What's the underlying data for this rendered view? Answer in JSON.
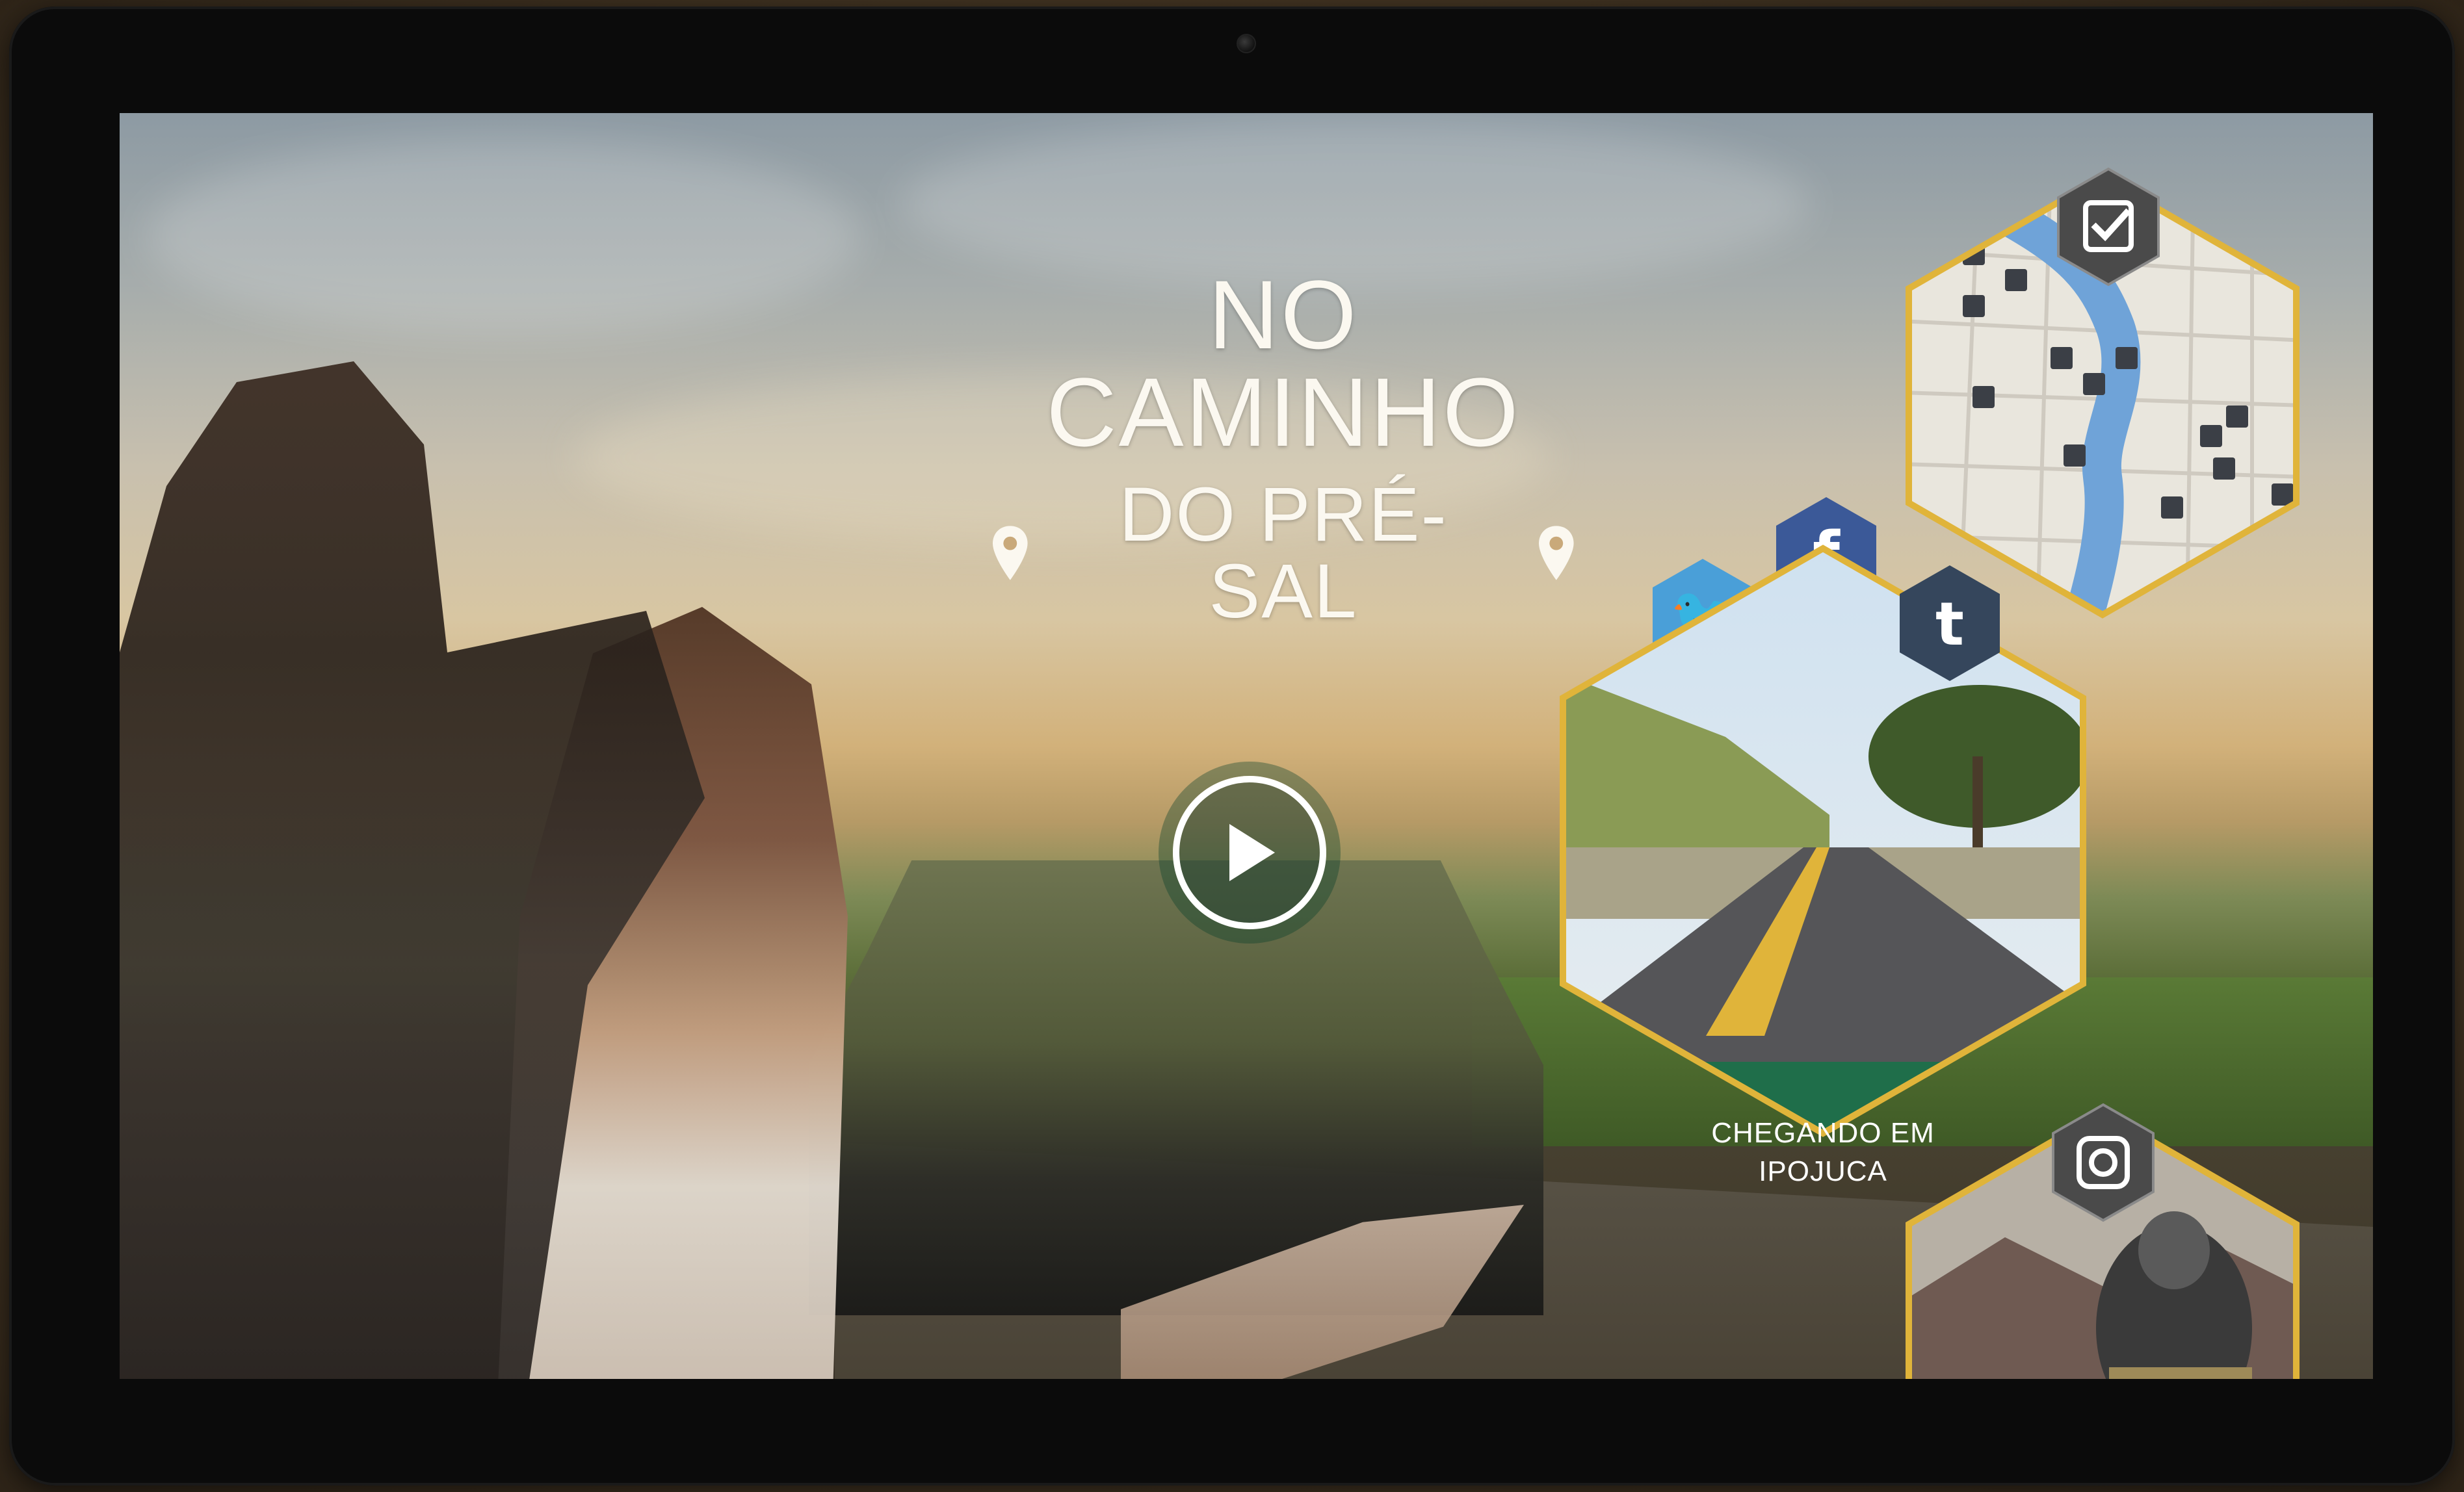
{
  "device": {
    "camera_icon": "camera-dot"
  },
  "hero": {
    "title_line1": "NO CAMINHO",
    "title_line2": "DO PRÉ-SAL",
    "pin_icon": "map-pin-icon"
  },
  "video": {
    "play_icon": "play-icon"
  },
  "map_tile": {
    "badge_icon": "checkin-icon"
  },
  "social": [
    {
      "name": "twitter",
      "glyph": "🐦",
      "color": "#4a9fd8"
    },
    {
      "name": "facebook",
      "glyph": "f",
      "color": "#3b5998"
    },
    {
      "name": "tumblr",
      "glyph": "t",
      "color": "#35465c"
    }
  ],
  "location_card": {
    "caption_line1": "CHEGANDO EM",
    "caption_line2": "IPOJUCA"
  },
  "instagram_tile": {
    "badge_icon": "instagram-icon"
  },
  "colors": {
    "hex_border": "#e0b43a",
    "caption_band": "#1f6e4a",
    "bezel": "#0b0b0b"
  }
}
